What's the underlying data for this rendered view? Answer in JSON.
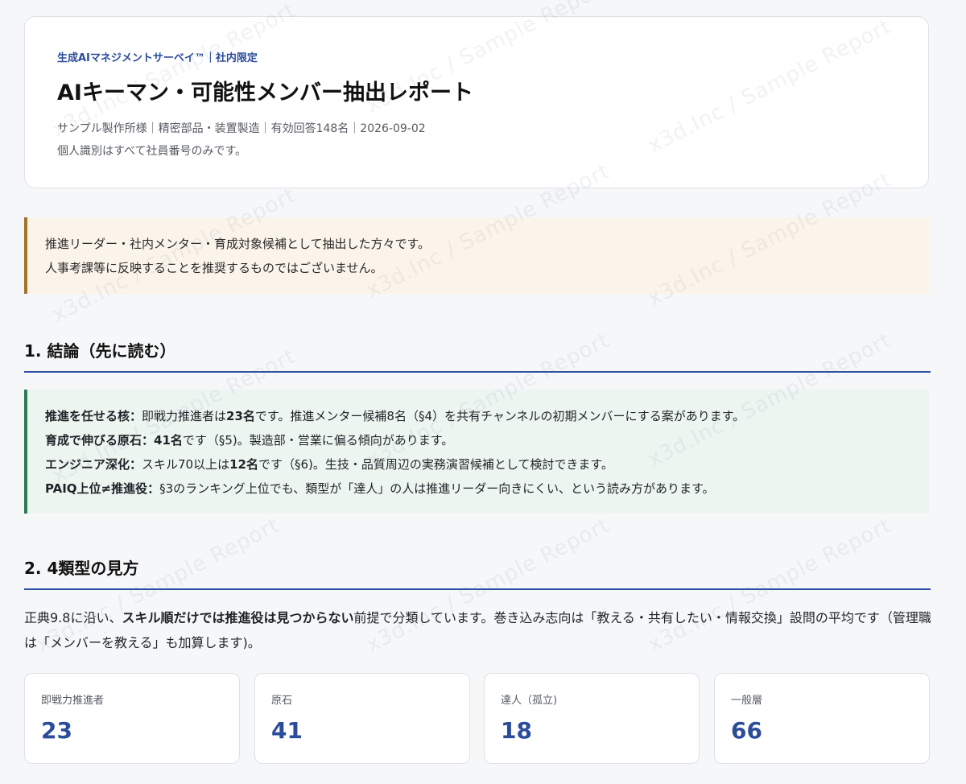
{
  "header": {
    "eyebrow": "生成AIマネジメントサーベイ™｜社内限定",
    "title": "AIキーマン・可能性メンバー抽出レポート",
    "meta": "サンプル製作所様｜精密部品・装置製造｜有効回答148名｜2026-09-02",
    "note": "個人識別はすべて社員番号のみです。"
  },
  "notice": {
    "line1": "推進リーダー・社内メンター・育成対象候補として抽出した方々です。",
    "line2": "人事考課等に反映することを推奨するものではございません。"
  },
  "section1": {
    "heading": "1. 結論（先に読む）",
    "items": [
      {
        "label": "推進を任せる核：",
        "t1": "即戦力推進者は",
        "b1": "23名",
        "t2": "です。推進メンター候補8名（§4）を共有チャンネルの初期メンバーにする案があります。"
      },
      {
        "label": "育成で伸びる原石：",
        "t1": "",
        "b1": "41名",
        "t2": "です（§5)。製造部・営業に偏る傾向があります。"
      },
      {
        "label": "エンジニア深化：",
        "t1": "スキル70以上は",
        "b1": "12名",
        "t2": "です（§6)。生技・品質周辺の実務演習候補として検討できます。"
      },
      {
        "label": "PAIQ上位≠推進役：",
        "t1": "§3のランキング上位でも、類型が「達人」の人は推進リーダー向きにくい、という読み方があります。",
        "b1": "",
        "t2": ""
      }
    ]
  },
  "section2": {
    "heading": "2. 4類型の見方",
    "para_pre": "正典9.8に沿い、",
    "para_bold": "スキル順だけでは推進役は見つからない",
    "para_post": "前提で分類しています。巻き込み志向は「教える・共有したい・情報交換」設問の平均です（管理職は「メンバーを教える」も加算します)。",
    "stats": [
      {
        "label": "即戦力推進者",
        "value": "23"
      },
      {
        "label": "原石",
        "value": "41"
      },
      {
        "label": "達人（孤立)",
        "value": "18"
      },
      {
        "label": "一般層",
        "value": "66"
      }
    ]
  },
  "watermark": "x3d.Inc / Sample Report",
  "colors": {
    "accent": "#2b4c9a",
    "notice_border": "#a3732a",
    "conclusion_border": "#2f7a54"
  }
}
